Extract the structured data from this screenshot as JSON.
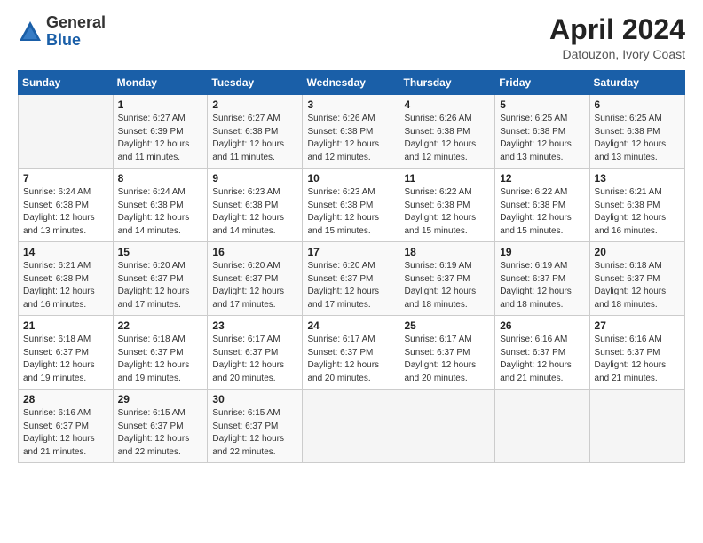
{
  "header": {
    "logo_line1": "General",
    "logo_line2": "Blue",
    "title": "April 2024",
    "location": "Datouzon, Ivory Coast"
  },
  "days_of_week": [
    "Sunday",
    "Monday",
    "Tuesday",
    "Wednesday",
    "Thursday",
    "Friday",
    "Saturday"
  ],
  "weeks": [
    [
      {
        "day": "",
        "info": ""
      },
      {
        "day": "1",
        "info": "Sunrise: 6:27 AM\nSunset: 6:39 PM\nDaylight: 12 hours\nand 11 minutes."
      },
      {
        "day": "2",
        "info": "Sunrise: 6:27 AM\nSunset: 6:38 PM\nDaylight: 12 hours\nand 11 minutes."
      },
      {
        "day": "3",
        "info": "Sunrise: 6:26 AM\nSunset: 6:38 PM\nDaylight: 12 hours\nand 12 minutes."
      },
      {
        "day": "4",
        "info": "Sunrise: 6:26 AM\nSunset: 6:38 PM\nDaylight: 12 hours\nand 12 minutes."
      },
      {
        "day": "5",
        "info": "Sunrise: 6:25 AM\nSunset: 6:38 PM\nDaylight: 12 hours\nand 13 minutes."
      },
      {
        "day": "6",
        "info": "Sunrise: 6:25 AM\nSunset: 6:38 PM\nDaylight: 12 hours\nand 13 minutes."
      }
    ],
    [
      {
        "day": "7",
        "info": "Sunrise: 6:24 AM\nSunset: 6:38 PM\nDaylight: 12 hours\nand 13 minutes."
      },
      {
        "day": "8",
        "info": "Sunrise: 6:24 AM\nSunset: 6:38 PM\nDaylight: 12 hours\nand 14 minutes."
      },
      {
        "day": "9",
        "info": "Sunrise: 6:23 AM\nSunset: 6:38 PM\nDaylight: 12 hours\nand 14 minutes."
      },
      {
        "day": "10",
        "info": "Sunrise: 6:23 AM\nSunset: 6:38 PM\nDaylight: 12 hours\nand 15 minutes."
      },
      {
        "day": "11",
        "info": "Sunrise: 6:22 AM\nSunset: 6:38 PM\nDaylight: 12 hours\nand 15 minutes."
      },
      {
        "day": "12",
        "info": "Sunrise: 6:22 AM\nSunset: 6:38 PM\nDaylight: 12 hours\nand 15 minutes."
      },
      {
        "day": "13",
        "info": "Sunrise: 6:21 AM\nSunset: 6:38 PM\nDaylight: 12 hours\nand 16 minutes."
      }
    ],
    [
      {
        "day": "14",
        "info": "Sunrise: 6:21 AM\nSunset: 6:38 PM\nDaylight: 12 hours\nand 16 minutes."
      },
      {
        "day": "15",
        "info": "Sunrise: 6:20 AM\nSunset: 6:37 PM\nDaylight: 12 hours\nand 17 minutes."
      },
      {
        "day": "16",
        "info": "Sunrise: 6:20 AM\nSunset: 6:37 PM\nDaylight: 12 hours\nand 17 minutes."
      },
      {
        "day": "17",
        "info": "Sunrise: 6:20 AM\nSunset: 6:37 PM\nDaylight: 12 hours\nand 17 minutes."
      },
      {
        "day": "18",
        "info": "Sunrise: 6:19 AM\nSunset: 6:37 PM\nDaylight: 12 hours\nand 18 minutes."
      },
      {
        "day": "19",
        "info": "Sunrise: 6:19 AM\nSunset: 6:37 PM\nDaylight: 12 hours\nand 18 minutes."
      },
      {
        "day": "20",
        "info": "Sunrise: 6:18 AM\nSunset: 6:37 PM\nDaylight: 12 hours\nand 18 minutes."
      }
    ],
    [
      {
        "day": "21",
        "info": "Sunrise: 6:18 AM\nSunset: 6:37 PM\nDaylight: 12 hours\nand 19 minutes."
      },
      {
        "day": "22",
        "info": "Sunrise: 6:18 AM\nSunset: 6:37 PM\nDaylight: 12 hours\nand 19 minutes."
      },
      {
        "day": "23",
        "info": "Sunrise: 6:17 AM\nSunset: 6:37 PM\nDaylight: 12 hours\nand 20 minutes."
      },
      {
        "day": "24",
        "info": "Sunrise: 6:17 AM\nSunset: 6:37 PM\nDaylight: 12 hours\nand 20 minutes."
      },
      {
        "day": "25",
        "info": "Sunrise: 6:17 AM\nSunset: 6:37 PM\nDaylight: 12 hours\nand 20 minutes."
      },
      {
        "day": "26",
        "info": "Sunrise: 6:16 AM\nSunset: 6:37 PM\nDaylight: 12 hours\nand 21 minutes."
      },
      {
        "day": "27",
        "info": "Sunrise: 6:16 AM\nSunset: 6:37 PM\nDaylight: 12 hours\nand 21 minutes."
      }
    ],
    [
      {
        "day": "28",
        "info": "Sunrise: 6:16 AM\nSunset: 6:37 PM\nDaylight: 12 hours\nand 21 minutes."
      },
      {
        "day": "29",
        "info": "Sunrise: 6:15 AM\nSunset: 6:37 PM\nDaylight: 12 hours\nand 22 minutes."
      },
      {
        "day": "30",
        "info": "Sunrise: 6:15 AM\nSunset: 6:37 PM\nDaylight: 12 hours\nand 22 minutes."
      },
      {
        "day": "",
        "info": ""
      },
      {
        "day": "",
        "info": ""
      },
      {
        "day": "",
        "info": ""
      },
      {
        "day": "",
        "info": ""
      }
    ]
  ]
}
